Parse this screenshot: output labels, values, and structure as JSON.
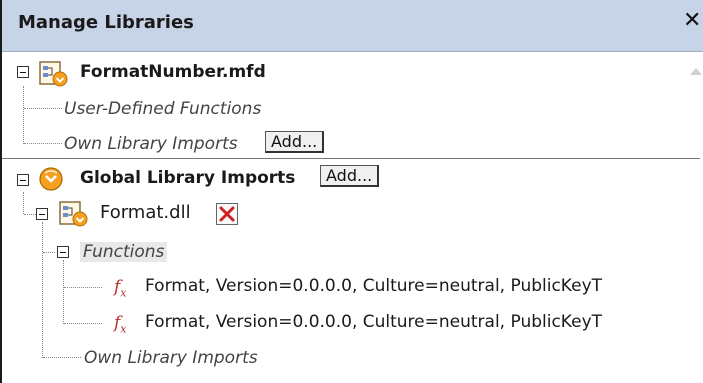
{
  "panel": {
    "title": "Manage Libraries",
    "close_glyph": "✕"
  },
  "tree": {
    "mapping_file": "FormatNumber.mfd",
    "udf_label": "User-Defined Functions",
    "own_imports_label": "Own Library Imports",
    "global_label": "Global Library Imports",
    "dll_name": "Format.dll",
    "functions_label": "Functions",
    "functions": [
      "Format, Version=0.0.0.0, Culture=neutral, PublicKeyT",
      "Format, Version=0.0.0.0, Culture=neutral, PublicKeyT"
    ],
    "dll_own_imports_label": "Own Library Imports"
  },
  "buttons": {
    "add": "Add..."
  },
  "icons": {
    "mapping": "mapping-file-icon",
    "global": "global-library-icon",
    "dll": "dll-library-icon",
    "function": "function-icon",
    "delete": "delete-x-icon"
  },
  "colors": {
    "titlebar": "#c7d4e8",
    "delete_red": "#d11f1f",
    "accent_orange": "#f5a020"
  }
}
